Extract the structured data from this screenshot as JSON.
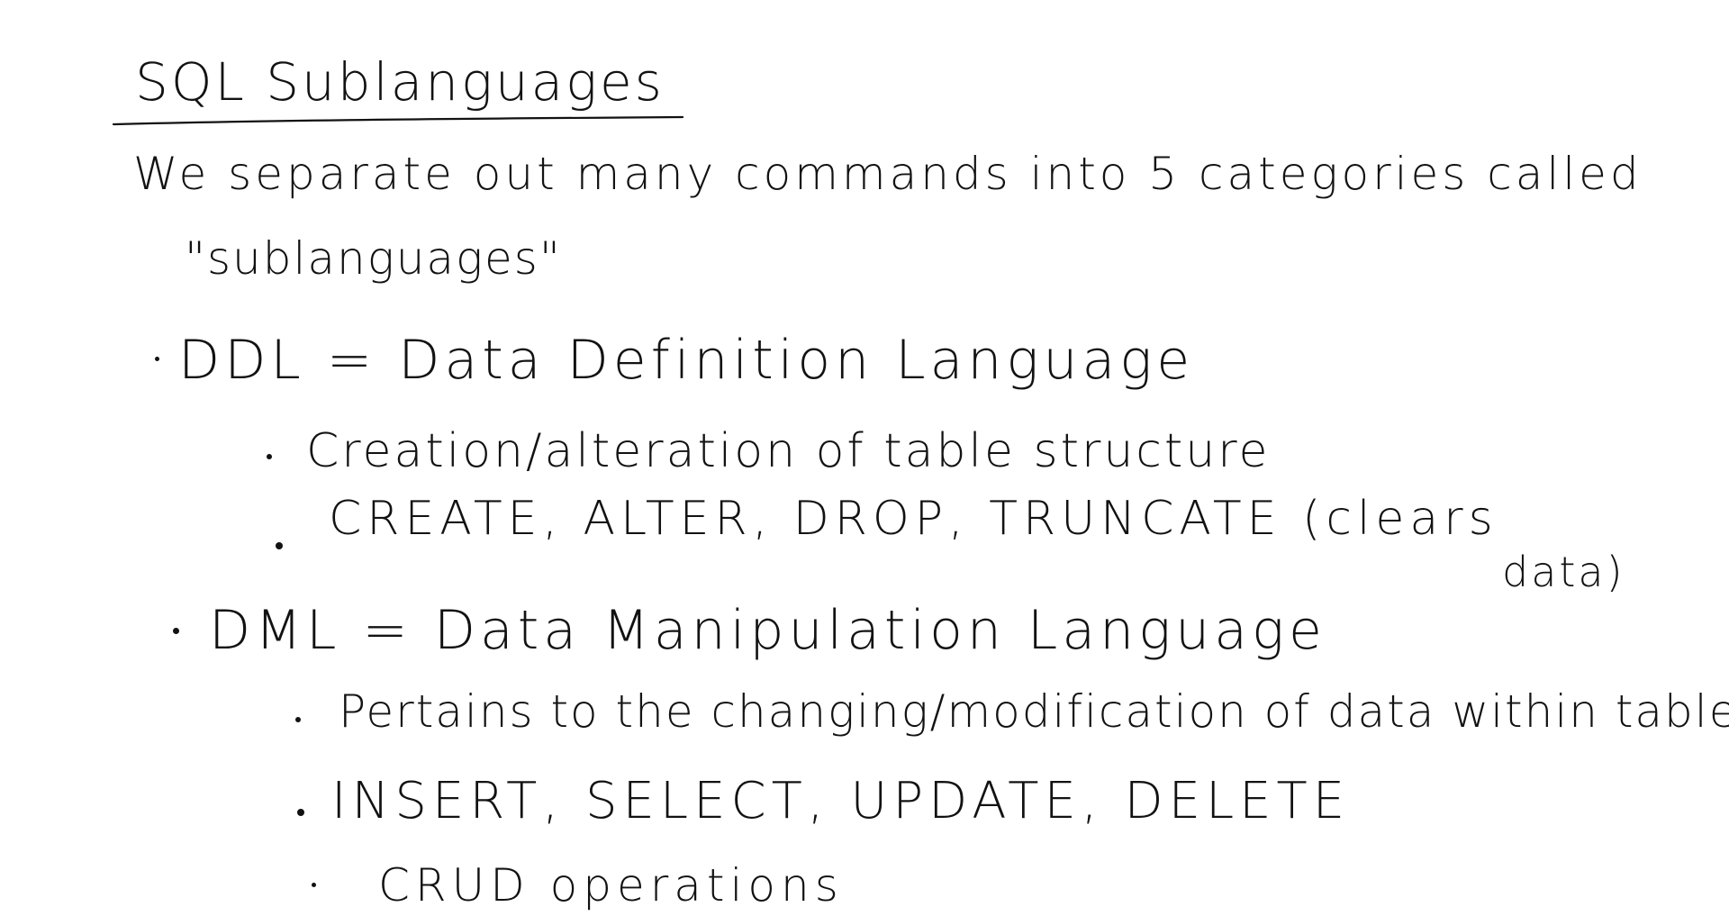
{
  "note": {
    "title": "SQL Sublanguages",
    "intro_line1": "We separate out many commands into 5 categories called",
    "intro_line2": "\"sublanguages\"",
    "ddl": {
      "heading": "DDL = Data Definition Language",
      "points": [
        "Creation/alteration of table structure",
        "CREATE, ALTER, DROP, TRUNCATE (clears",
        "data)"
      ]
    },
    "dml": {
      "heading": "DML = Data Manipulation Language",
      "points": [
        "Pertains to the changing/modification of data within table",
        "INSERT, SELECT, UPDATE, DELETE",
        "CRUD operations"
      ]
    }
  },
  "colors": {
    "ink": "#121212",
    "background": "#ffffff"
  }
}
